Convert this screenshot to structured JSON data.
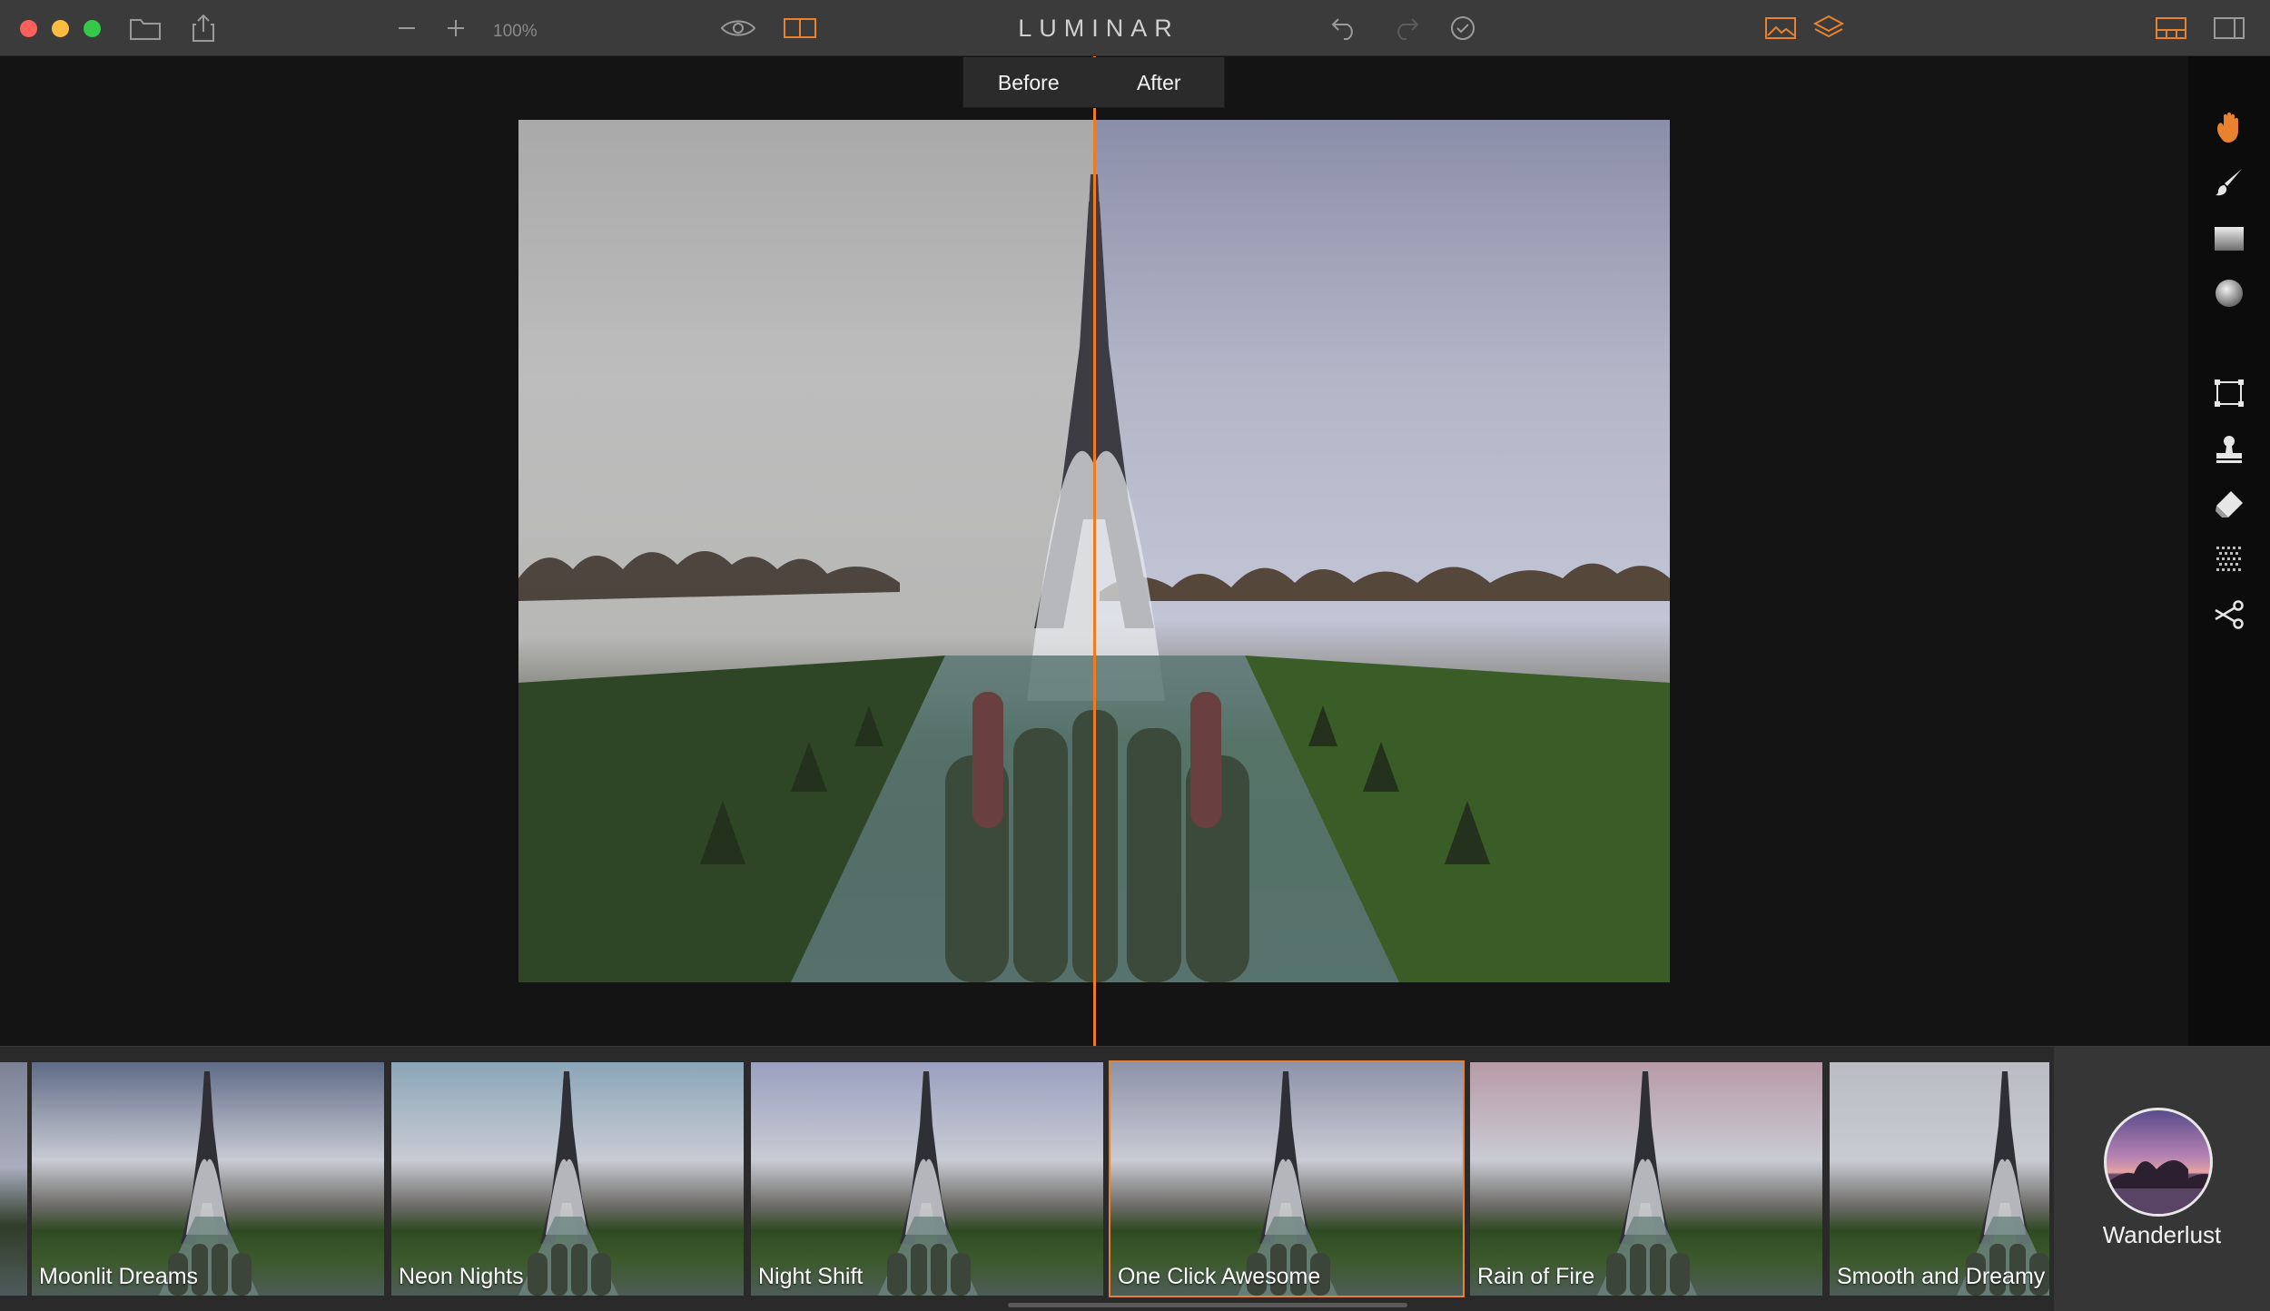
{
  "window": {
    "title": "LUMINAR",
    "zoom": "100%"
  },
  "compare": {
    "before_label": "Before",
    "after_label": "After"
  },
  "toolbar_icons": [
    "folder-icon",
    "share-icon",
    "zoom-out-icon",
    "zoom-in-icon",
    "eye-icon",
    "compare-icon",
    "undo-icon",
    "redo-icon",
    "history-icon",
    "presets-icon",
    "layers-icon",
    "filmstrip-layout-icon",
    "sidebar-icon"
  ],
  "tools": [
    "hand-icon",
    "brush-icon",
    "gradient-icon",
    "radial-icon",
    "crop-icon",
    "clone-stamp-icon",
    "erase-icon",
    "noise-icon",
    "cut-icon"
  ],
  "presets": [
    {
      "label": "Moonlit Dreams",
      "tone": "#5f6b86"
    },
    {
      "label": "Neon Nights",
      "tone": "#8aa6b8"
    },
    {
      "label": "Night Shift",
      "tone": "#9aa0bf"
    },
    {
      "label": "One Click Awesome",
      "tone": "#8d92a8"
    },
    {
      "label": "Rain of Fire",
      "tone": "#b79aa6"
    },
    {
      "label": "Smooth and Dreamy",
      "tone": "#b9bcc3"
    }
  ],
  "selected_preset": "One Click Awesome",
  "category": {
    "label": "Wanderlust"
  },
  "colors": {
    "accent": "#f07a1c",
    "titlebar": "#3b3b3b",
    "filmstrip": "#2a2a2a"
  }
}
